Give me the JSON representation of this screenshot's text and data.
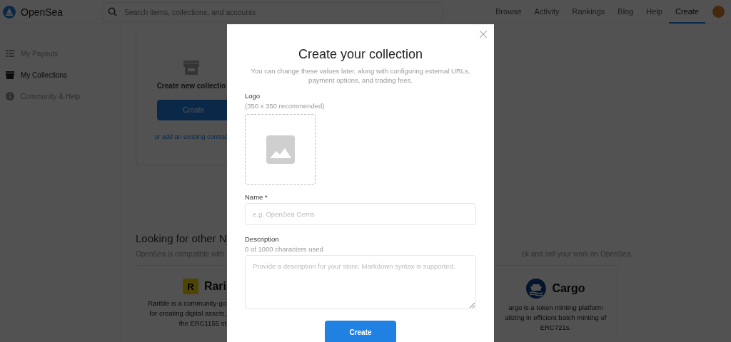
{
  "header": {
    "logo_text": "OpenSea",
    "search": {
      "placeholder": "Search items, collections, and accounts"
    },
    "nav": [
      {
        "label": "Browse",
        "selected": false
      },
      {
        "label": "Activity",
        "selected": false
      },
      {
        "label": "Rankings",
        "selected": false
      },
      {
        "label": "Blog",
        "selected": false
      },
      {
        "label": "Help",
        "selected": false
      },
      {
        "label": "Create",
        "selected": true
      }
    ]
  },
  "sidebar": {
    "items": [
      {
        "label": "My Payouts",
        "selected": false
      },
      {
        "label": "My Collections",
        "selected": true
      },
      {
        "label": "Community & Help",
        "selected": false
      }
    ]
  },
  "create_card": {
    "title": "Create new collectio",
    "button": "Create",
    "link": "or add an existing contrac"
  },
  "partners": {
    "title": "Looking for other N",
    "subtitle_left": "OpenSea is compatible with",
    "subtitle_right": "ck and sell your work on OpenSea.",
    "cards": [
      {
        "kind": "letter",
        "logo_letter": "R",
        "name": "Rari",
        "lines": [
          "Rarible is a community-go",
          "for creating digital assets,",
          "the ERC1155 st"
        ]
      },
      {
        "kind": "ship",
        "name": "Cargo",
        "lines": [
          "argo is a token minting platform",
          "alizing in efficient batch minting of",
          "ERC721s."
        ]
      }
    ]
  },
  "modal": {
    "title": "Create your collection",
    "subtitle": "You can change these values later, along with configuring external URLs, payment options, and trading fees.",
    "logo": {
      "label": "Logo",
      "hint": "(350 x 350 recommended)"
    },
    "name": {
      "label": "Name *",
      "placeholder": "e.g. OpenSea Gems"
    },
    "description": {
      "label": "Description",
      "counter": "0 of 1000 characters used",
      "placeholder": "Provide a description for your store. Markdown syntax is supported."
    },
    "submit": "Create"
  }
}
